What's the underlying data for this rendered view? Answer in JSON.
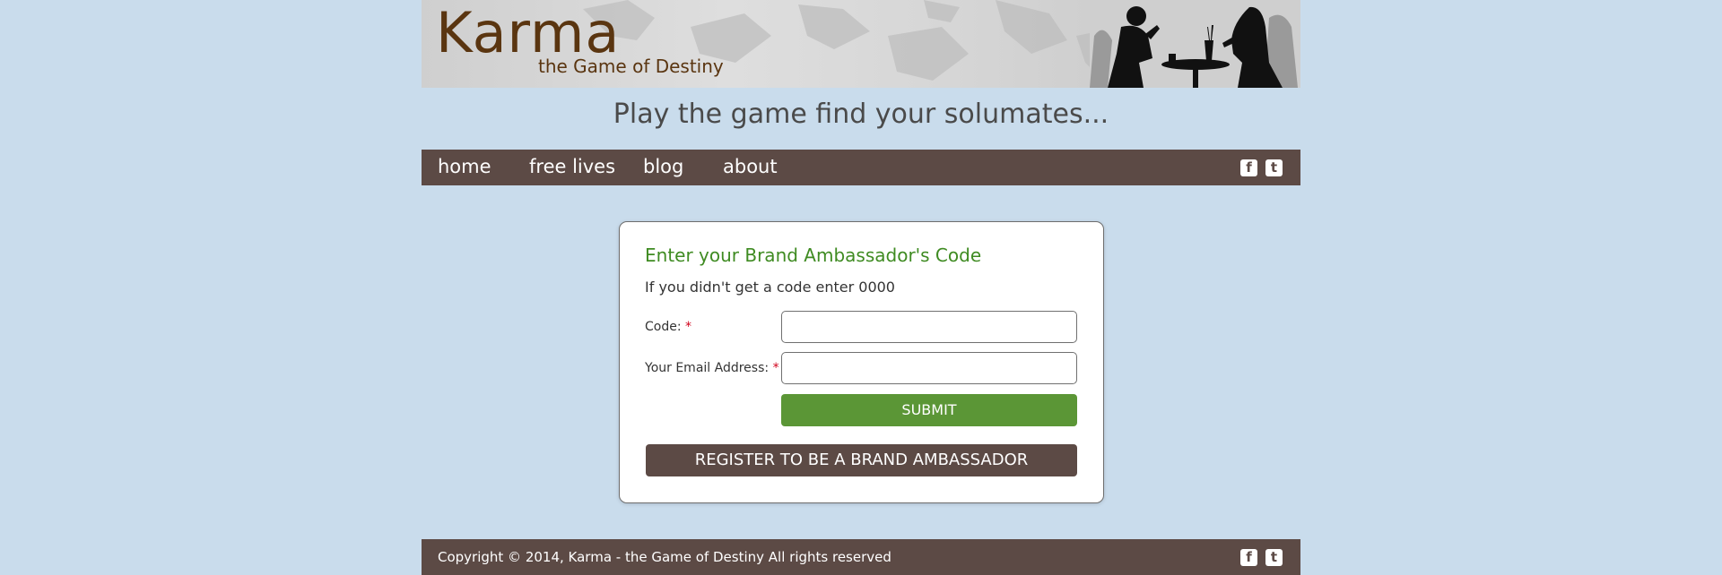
{
  "header": {
    "brand": "Karma",
    "tagline": "the Game of Destiny",
    "slogan": "Play the game find your solumates..."
  },
  "nav": {
    "items": [
      {
        "label": "home"
      },
      {
        "label": "free lives"
      },
      {
        "label": "blog"
      },
      {
        "label": "about"
      }
    ],
    "social": {
      "facebook_glyph": "f",
      "twitter_glyph": "t"
    }
  },
  "form": {
    "title": "Enter your Brand Ambassador's Code",
    "hint": "If you didn't get a code enter 0000",
    "code_label": "Code:",
    "email_label": "Your Email Address:",
    "required_mark": "*",
    "code_value": "",
    "email_value": "",
    "submit_label": "SUBMIT",
    "register_label": "REGISTER TO BE A BRAND AMBASSADOR"
  },
  "footer": {
    "copyright": "Copyright © 2014, Karma - the Game of Destiny  All rights reserved"
  },
  "colors": {
    "page_bg": "#c9dcec",
    "bar_brown": "#5c4a45",
    "accent_green": "#5b9636",
    "title_green": "#3f8b22",
    "brand_brown": "#5a3510"
  },
  "icons": [
    "facebook-icon",
    "twitter-icon"
  ]
}
